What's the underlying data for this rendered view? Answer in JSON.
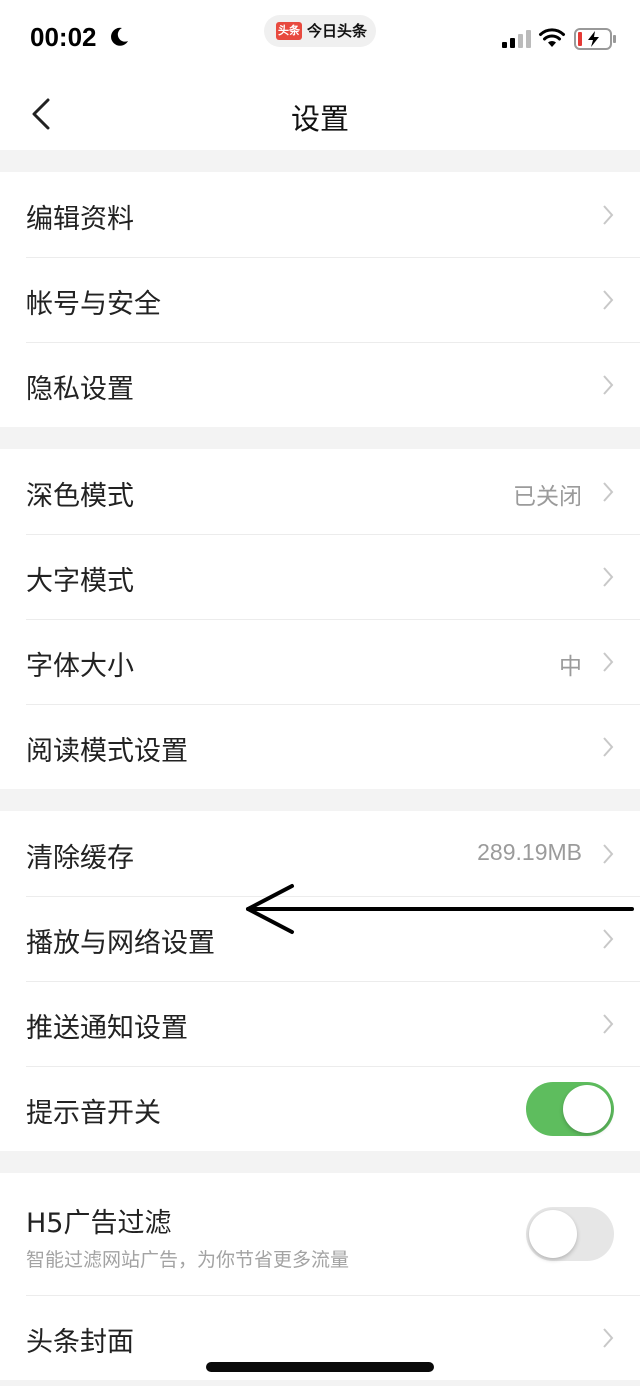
{
  "status_bar": {
    "time": "00:02",
    "app_logo": "头条",
    "app_name": "今日头条",
    "icons": [
      "moon-icon",
      "signal-icon",
      "wifi-icon",
      "battery-charging-icon"
    ]
  },
  "nav": {
    "title": "设置",
    "back_icon": "chevron-left-icon"
  },
  "groups": [
    {
      "items": [
        {
          "label": "编辑资料"
        },
        {
          "label": "帐号与安全"
        },
        {
          "label": "隐私设置"
        }
      ]
    },
    {
      "items": [
        {
          "label": "深色模式",
          "value": "已关闭"
        },
        {
          "label": "大字模式"
        },
        {
          "label": "字体大小",
          "value": "中"
        },
        {
          "label": "阅读模式设置"
        }
      ]
    },
    {
      "items": [
        {
          "label": "清除缓存",
          "value": "289.19MB"
        },
        {
          "label": "播放与网络设置"
        },
        {
          "label": "推送通知设置"
        },
        {
          "label": "提示音开关",
          "toggle": true
        }
      ]
    },
    {
      "items": [
        {
          "label": "H5广告过滤",
          "subtitle": "智能过滤网站广告，为你节省更多流量",
          "toggle": false
        },
        {
          "label": "头条封面"
        }
      ]
    }
  ],
  "colors": {
    "toggle_on": "#5ebd5e",
    "toggle_off": "#e6e6e6",
    "accent_logo": "#e84a3f"
  }
}
